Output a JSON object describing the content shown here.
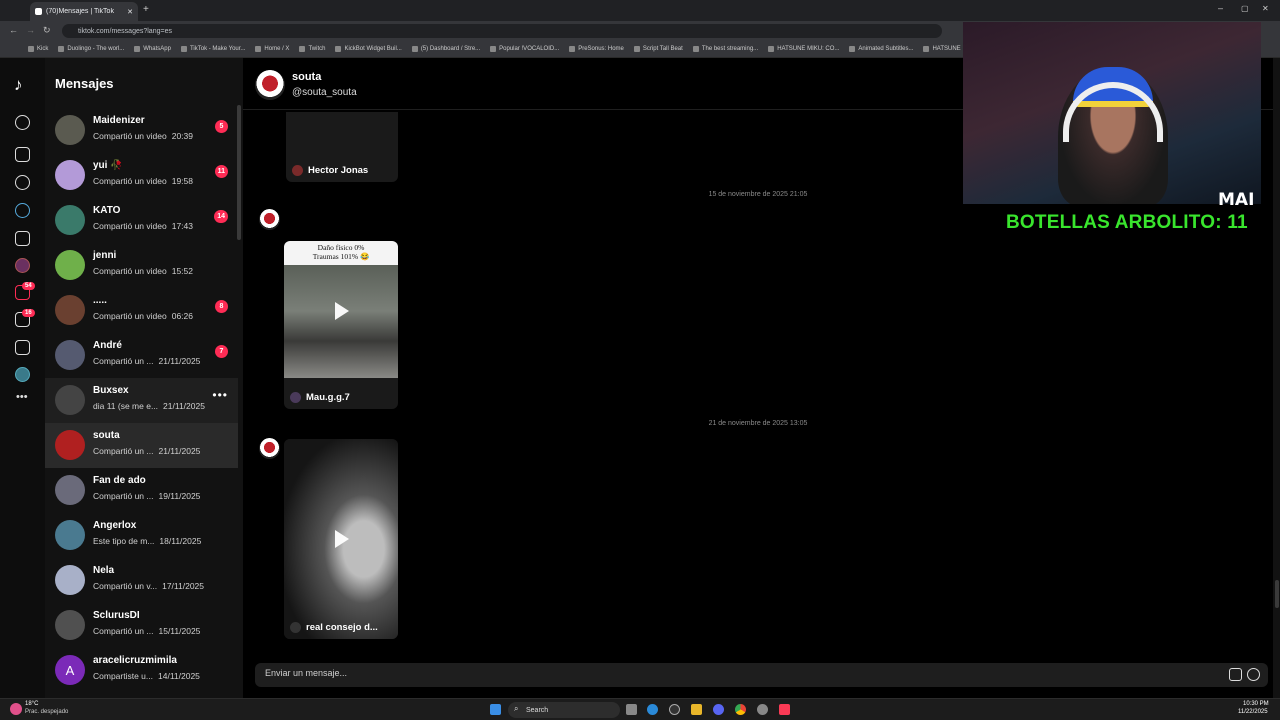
{
  "browser": {
    "tab_title": "(70)Mensajes | TikTok",
    "url": "tiktok.com/messages?lang=es",
    "bookmarks": [
      "Kick",
      "Duolingo - The worl...",
      "WhatsApp",
      "TikTok - Make Your...",
      "Home / X",
      "Twitch",
      "KickBot Widget Buil...",
      "(5) Dashboard / Stre...",
      "Popular !VOCALOID...",
      "PreSonus: Home",
      "Script Tall Beat",
      "The best streaming...",
      "HATSUNE MIKU: CO...",
      "Animated Subtitles...",
      "HATSUNE"
    ]
  },
  "rail": {
    "badges": {
      "activity": "54",
      "inbox": "16"
    }
  },
  "sidebar": {
    "title": "Mensajes",
    "conversations": [
      {
        "name": "Maidenizer",
        "preview": "Compartió un video",
        "time": "20:39",
        "count": "5",
        "color": "#5a5a50"
      },
      {
        "name": "yui 🥀",
        "preview": "Compartió un video",
        "time": "19:58",
        "count": "11",
        "color": "#b39ad8"
      },
      {
        "name": "KATO",
        "preview": "Compartió un video",
        "time": "17:43",
        "count": "14",
        "color": "#3a7a6a"
      },
      {
        "name": "jenni",
        "preview": "Compartió un video",
        "time": "15:52",
        "count": "",
        "color": "#6fb04a"
      },
      {
        "name": ".....",
        "preview": "Compartió un video",
        "time": "06:26",
        "count": "8",
        "color": "#6a4030"
      },
      {
        "name": "André",
        "preview": "Compartió un ...",
        "time": "21/11/2025",
        "count": "7",
        "color": "#555a70"
      },
      {
        "name": "Buxsex",
        "preview": "dia 11 (se me e...",
        "time": "21/11/2025",
        "count": "",
        "color": "#444"
      },
      {
        "name": "souta",
        "preview": "Compartió un ...",
        "time": "21/11/2025",
        "count": "",
        "color": "#b02020"
      },
      {
        "name": "Fan de ado",
        "preview": "Compartió un ...",
        "time": "19/11/2025",
        "count": "",
        "color": "#6a6a7a"
      },
      {
        "name": "Angerlox",
        "preview": "Este tipo de m...",
        "time": "18/11/2025",
        "count": "",
        "color": "#4a7a90"
      },
      {
        "name": "Nela",
        "preview": "Compartió un v...",
        "time": "17/11/2025",
        "count": "",
        "color": "#a8b0c8"
      },
      {
        "name": "SclurusDI",
        "preview": "Compartió un ...",
        "time": "15/11/2025",
        "count": "",
        "color": "#505050"
      },
      {
        "name": "aracelicruzmimila",
        "preview": "Compartiste u...",
        "time": "14/11/2025",
        "count": "",
        "color": "#7b2ab8",
        "initial": "A"
      }
    ],
    "more_glyph": "•••"
  },
  "chat": {
    "name": "souta",
    "handle": "@souta_souta",
    "cards": [
      {
        "author": "Hector Jonas"
      },
      {
        "caption_line1": "Daño físico 0%",
        "caption_line2": "Traumas 101% 😂",
        "author": "Mau.g.g.7"
      },
      {
        "author": "real consejo d..."
      }
    ],
    "timestamps": [
      "15 de noviembre de 2025 21:05",
      "21 de noviembre de 2025 13:05"
    ],
    "input_placeholder": "Enviar un mensaje..."
  },
  "overlay": {
    "counter": "BOTELLAS ARBOLITO: 11",
    "logo": "MAI"
  },
  "taskbar": {
    "weather_temp": "18°C",
    "weather_desc": "Prac. despejado",
    "search": "Search",
    "time": "10:30 PM",
    "date": "11/22/2025"
  }
}
